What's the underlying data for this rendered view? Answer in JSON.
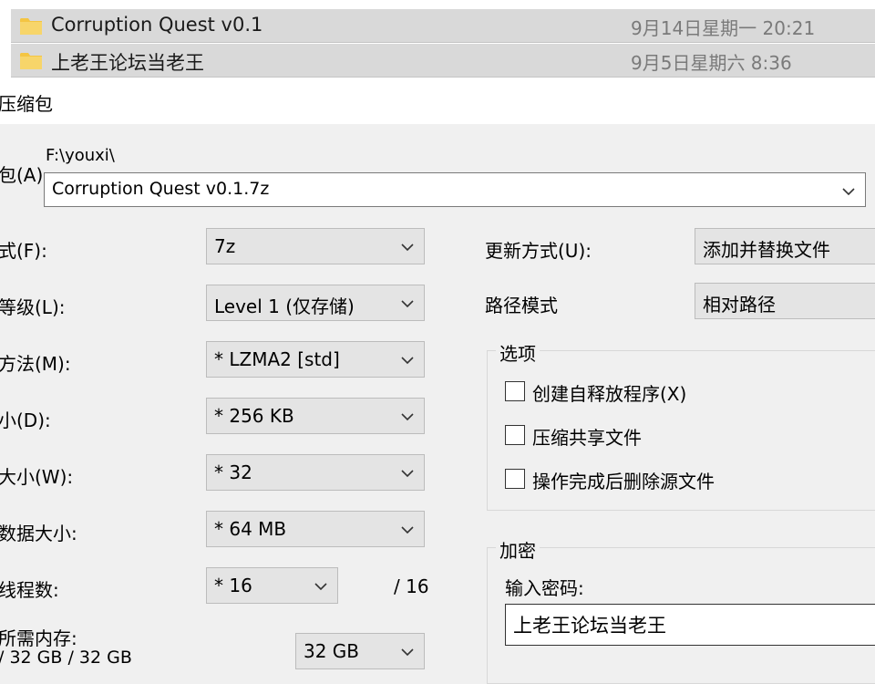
{
  "explorer": {
    "rows": [
      {
        "name": "Corruption Quest v0.1",
        "date": "9月14日星期一 20:21"
      },
      {
        "name": "上老王论坛当老王",
        "date": "9月5日星期六 8:36"
      }
    ]
  },
  "dialog": {
    "title": "压缩包",
    "archive": {
      "label": "包(A)",
      "path": "F:\\youxi\\",
      "filename": "Corruption Quest v0.1.7z"
    },
    "left": {
      "format": {
        "label": "式(F):",
        "value": "7z"
      },
      "level": {
        "label": "等级(L):",
        "value": "Level 1 (仅存储)"
      },
      "method": {
        "label": "方法(M):",
        "value": "* LZMA2 [std]"
      },
      "dict": {
        "label": "小(D):",
        "value": "* 256 KB"
      },
      "word": {
        "label": "大小(W):",
        "value": "* 32"
      },
      "solid": {
        "label": "数据大小:",
        "value": "* 64 MB"
      },
      "threads": {
        "label": "线程数:",
        "value": "* 16",
        "max": "/ 16"
      },
      "memory": {
        "label": "所需内存:",
        "detail": "/ 32 GB / 32 GB",
        "value": "32 GB"
      }
    },
    "right": {
      "update": {
        "label": "更新方式(U):",
        "value": "添加并替换文件"
      },
      "path_mode": {
        "label": "路径模式",
        "value": "相对路径"
      },
      "options": {
        "title": "选项",
        "items": [
          "创建自释放程序(X)",
          "压缩共享文件",
          "操作完成后删除源文件"
        ]
      },
      "encryption": {
        "title": "加密",
        "password_label": "输入密码:",
        "password_value": "上老王论坛当老王"
      }
    }
  },
  "colors": {
    "folder": "#f4c542",
    "dialog_bg": "#f0f0f0",
    "field_bg": "#e4e4e4"
  }
}
